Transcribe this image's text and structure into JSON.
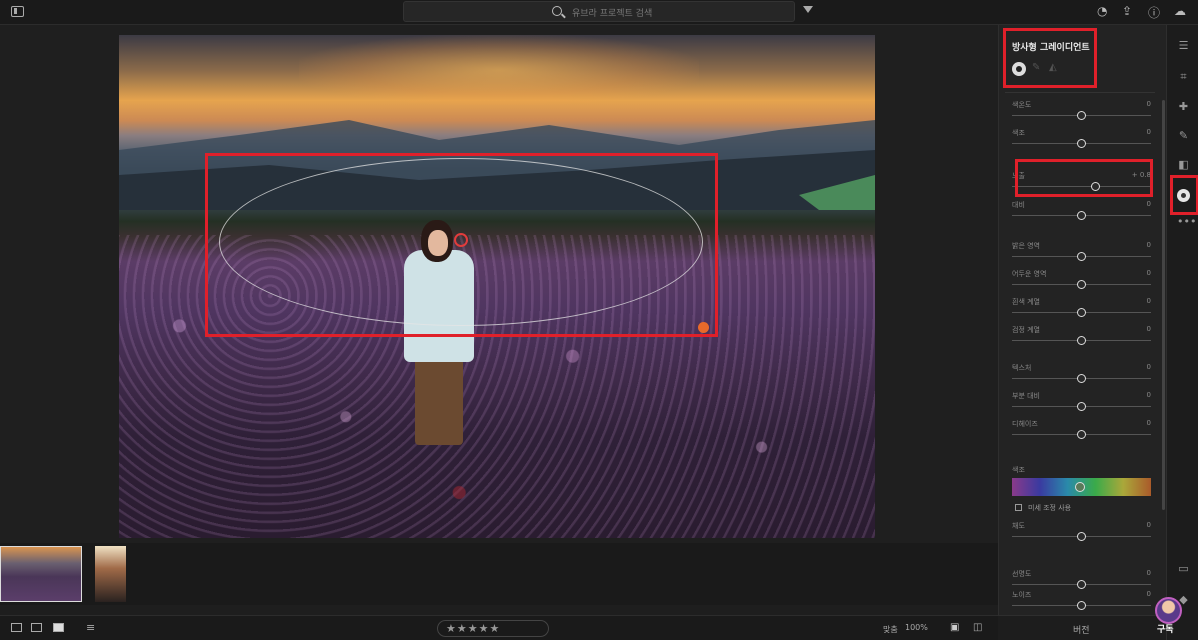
{
  "topbar": {
    "search_placeholder": "유브라 프로젝트 검색"
  },
  "panel": {
    "title": "방사형 그레이디언트",
    "sliders": [
      {
        "label": "색온도",
        "value": "0",
        "level": 0.5
      },
      {
        "label": "색조",
        "value": "0",
        "level": 0.5
      },
      {
        "label": "노출",
        "value": "+ 0.8",
        "level": 0.6
      },
      {
        "label": "대비",
        "value": "0",
        "level": 0.5
      },
      {
        "label": "밝은 영역",
        "value": "0",
        "level": 0.5
      },
      {
        "label": "어두운 영역",
        "value": "0",
        "level": 0.5
      },
      {
        "label": "흰색 계열",
        "value": "0",
        "level": 0.5
      },
      {
        "label": "검정 계열",
        "value": "0",
        "level": 0.5
      },
      {
        "label": "텍스처",
        "value": "0",
        "level": 0.5
      },
      {
        "label": "부분 대비",
        "value": "0",
        "level": 0.5
      },
      {
        "label": "디헤이즈",
        "value": "0",
        "level": 0.5
      },
      {
        "label": "채도",
        "value": "0",
        "level": 0.5
      },
      {
        "label": "선명도",
        "value": "0",
        "level": 0.5
      },
      {
        "label": "노이즈",
        "value": "0",
        "level": 0.5
      }
    ],
    "hue_label": "색조",
    "fine_adjust_label": "미세 조정 사용"
  },
  "bottombar": {
    "stars": "★★★★★",
    "zoom_label": "맞춤",
    "zoom_value": "100%"
  },
  "version_label": "버전",
  "subscribe_label": "구독",
  "colors": {
    "highlight_box": "#e0202a",
    "handle": "#e86a2a"
  },
  "icons": [
    "panel-toggle-icon",
    "search-icon",
    "filter-icon",
    "bell-icon",
    "share-icon",
    "help-icon",
    "cloud-icon",
    "edit-sliders-icon",
    "crop-icon",
    "healing-icon",
    "brush-icon",
    "linear-gradient-icon",
    "radial-gradient-icon",
    "more-icon",
    "comment-icon",
    "tag-icon"
  ]
}
